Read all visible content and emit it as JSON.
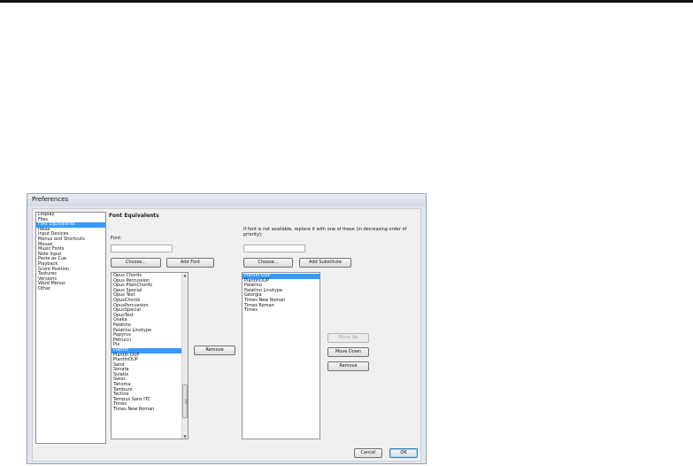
{
  "window": {
    "title": "Preferences"
  },
  "categories": {
    "items": [
      "Display",
      "Files",
      "Font Equivalents",
      "Ideas",
      "Input Devices",
      "Menus and Shortcuts",
      "Mouse",
      "Music Fonts",
      "Note Input",
      "Paste as Cue",
      "Playback",
      "Score Position",
      "Textures",
      "Versions",
      "Word Menus",
      "Other"
    ],
    "selected_index": 2
  },
  "section": {
    "heading": "Font Equivalents"
  },
  "font": {
    "label": "Font:",
    "value": "",
    "choose_label": "Choose...",
    "add_label": "Add Font",
    "remove_label": "Remove",
    "items": [
      "Opus Chords",
      "Opus Percussion",
      "Opus PlainChords",
      "Opus Special",
      "Opus Text",
      "OpusChords",
      "OpusPercussion",
      "OpusSpecial",
      "OpusText",
      "Osaka",
      "Palatino",
      "Palatino Linotype",
      "Papyrus",
      "Petrucci",
      "Pix",
      "Plantin",
      "Plantin OUP",
      "PlantinOUP",
      "Sand",
      "Sonata",
      "Sulatix",
      "Swiss",
      "Tahoma",
      "Tamburo",
      "Techno",
      "Tempus Sans ITC",
      "Times",
      "Times New Roman"
    ],
    "selected_index": 15
  },
  "substitute": {
    "label": "If font is not available, replace it with one of these (in decreasing order of priority):",
    "value": "",
    "choose_label": "Choose...",
    "add_label": "Add Substitute",
    "items": [
      "Plantin OUP",
      "PlantinOUP",
      "Palatino",
      "Palatino Linotype",
      "Georgia",
      "Times New Roman",
      "Times Roman",
      "Times"
    ],
    "selected_index": 0,
    "move_up_label": "Move Up",
    "move_down_label": "Move Down",
    "remove_label": "Remove"
  },
  "footer": {
    "cancel_label": "Cancel",
    "ok_label": "OK"
  }
}
